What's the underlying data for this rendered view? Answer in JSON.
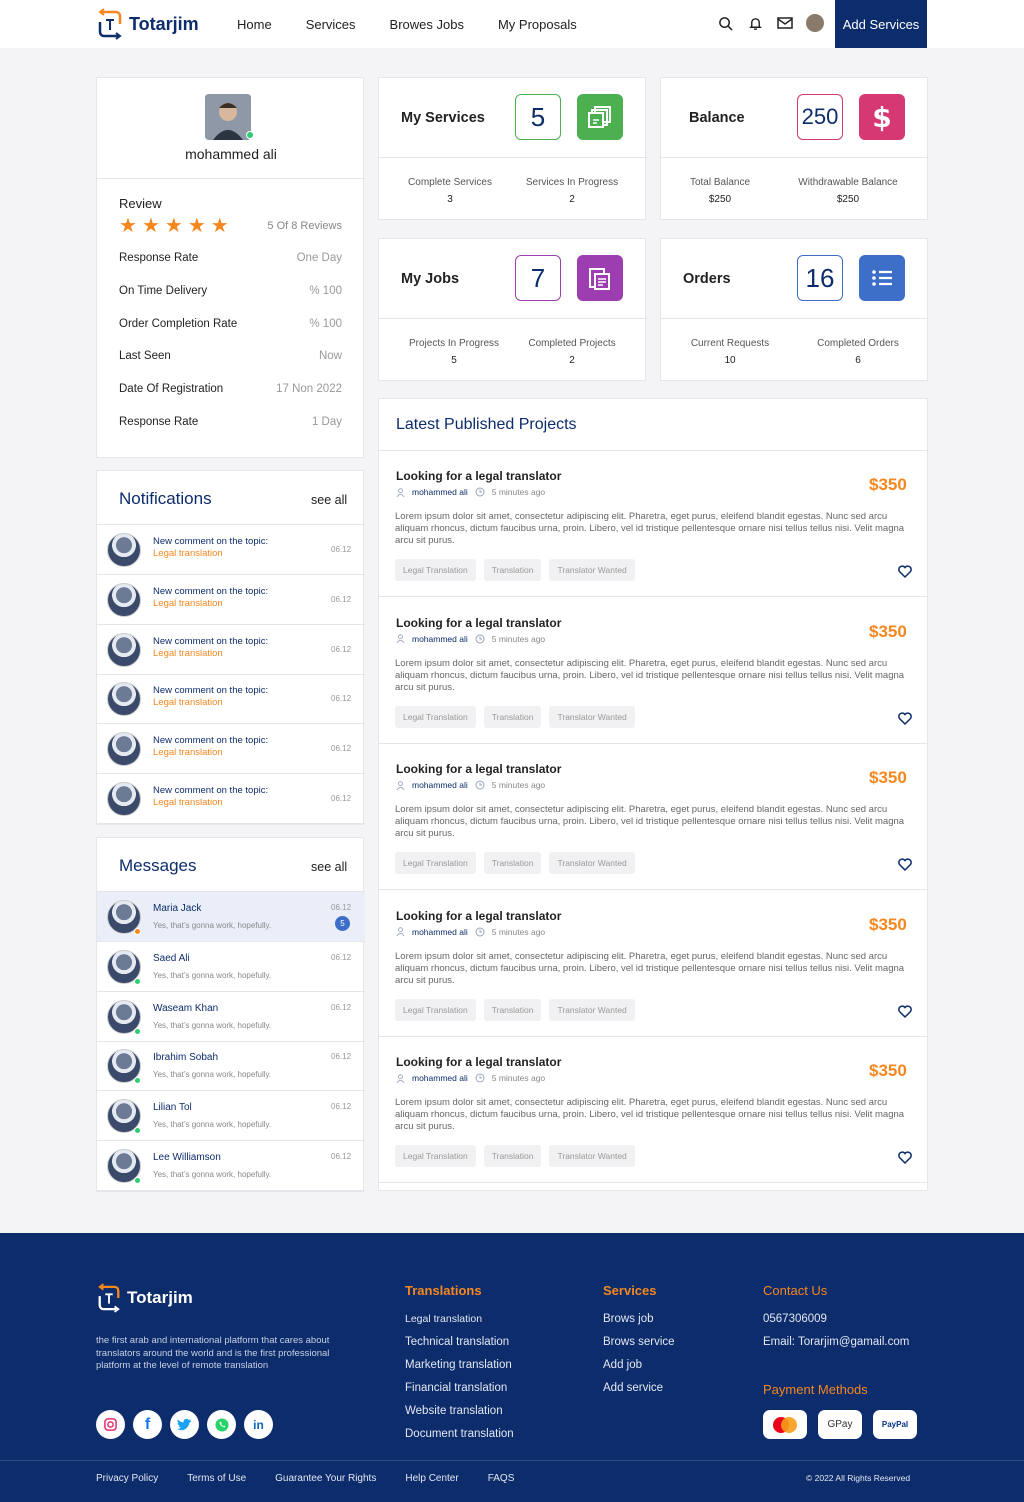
{
  "brand": {
    "name": "Totarjim"
  },
  "nav": [
    "Home",
    "Services",
    "Browes Jobs",
    "My Proposals"
  ],
  "header": {
    "add_button": "Add Services"
  },
  "profile": {
    "name": "mohammed ali",
    "review_label": "Review",
    "rating": 5,
    "review_count": "5 Of 8 Reviews",
    "stats": [
      {
        "label": "Response Rate",
        "value": "One Day"
      },
      {
        "label": "On Time Delivery",
        "value": "% 100"
      },
      {
        "label": "Order Completion Rate",
        "value": "% 100"
      },
      {
        "label": "Last Seen",
        "value": "Now"
      },
      {
        "label": "Date Of Registration",
        "value": "17 Non 2022"
      },
      {
        "label": "Response Rate",
        "value": "1 Day"
      }
    ]
  },
  "stat_boxes": [
    {
      "title": "My Services",
      "number": "5",
      "color": "#4caf50",
      "left_label": "Complete Services",
      "left_value": "3",
      "right_label": "Services In Progress",
      "right_value": "2"
    },
    {
      "title": "Balance",
      "number": "250",
      "color": "#d63874",
      "left_label": "Total Balance",
      "left_value": "$250",
      "right_label": "Withdrawable Balance",
      "right_value": "$250"
    },
    {
      "title": "My Jobs",
      "number": "7",
      "color": "#9c3eb0",
      "left_label": "Projects In Progress",
      "left_value": "5",
      "right_label": "Completed Projects",
      "right_value": "2"
    },
    {
      "title": "Orders",
      "number": "16",
      "color": "#3d6fc9",
      "left_label": "Current Requests",
      "left_value": "10",
      "right_label": "Completed Orders",
      "right_value": "6"
    }
  ],
  "notifications": {
    "title": "Notifications",
    "see_all": "see all",
    "items": [
      {
        "text": "New comment on the topic:",
        "topic": "Legal translation",
        "time": "06.12"
      },
      {
        "text": "New comment on the topic:",
        "topic": "Legal translation",
        "time": "06.12"
      },
      {
        "text": "New comment on the topic:",
        "topic": "Legal translation",
        "time": "06.12"
      },
      {
        "text": "New comment on the topic:",
        "topic": "Legal translation",
        "time": "06.12"
      },
      {
        "text": "New comment on the topic:",
        "topic": "Legal translation",
        "time": "06.12"
      },
      {
        "text": "New comment on the topic:",
        "topic": "Legal translation",
        "time": "06.12"
      }
    ]
  },
  "messages": {
    "title": "Messages",
    "see_all": "see all",
    "items": [
      {
        "name": "Maria Jack",
        "text": "Yes, that’s gonna work, hopefully.",
        "time": "06.12",
        "badge": "5",
        "status_color": "#f5871f"
      },
      {
        "name": "Saed Ali",
        "text": "Yes, that’s gonna work, hopefully.",
        "time": "06.12",
        "badge": "",
        "status_color": "#2ecc71"
      },
      {
        "name": "Waseam Khan",
        "text": "Yes, that’s gonna work, hopefully.",
        "time": "06.12",
        "badge": "",
        "status_color": "#2ecc71"
      },
      {
        "name": "Ibrahim Sobah",
        "text": "Yes, that’s gonna work, hopefully.",
        "time": "06.12",
        "badge": "",
        "status_color": "#2ecc71"
      },
      {
        "name": "Lilian Tol",
        "text": "Yes, that’s gonna work, hopefully.",
        "time": "06.12",
        "badge": "",
        "status_color": "#2ecc71"
      },
      {
        "name": "Lee Williamson",
        "text": "Yes, that’s gonna work, hopefully.",
        "time": "06.12",
        "badge": "",
        "status_color": "#2ecc71"
      }
    ]
  },
  "latest": {
    "title": "Latest Published Projects",
    "projects": [
      {
        "title": "Looking for a legal translator",
        "author": "mohammed ali",
        "time": "5 minutes ago",
        "price": "$350",
        "desc": "Lorem ipsum dolor sit amet, consectetur adipiscing elit. Pharetra, eget purus, eleifend blandit egestas. Nunc sed arcu aliquam rhoncus, dictum faucibus urna, proin. Libero, vel id tristique pellentesque ornare nisi tellus tellus nisi. Velit magna arcu sit purus.",
        "tags": [
          "Legal Translation",
          "Translation",
          "Translator Wanted"
        ]
      },
      {
        "title": "Looking for a legal translator",
        "author": "mohammed ali",
        "time": "5 minutes ago",
        "price": "$350",
        "desc": "Lorem ipsum dolor sit amet, consectetur adipiscing elit. Pharetra, eget purus, eleifend blandit egestas. Nunc sed arcu aliquam rhoncus, dictum faucibus urna, proin. Libero, vel id tristique pellentesque ornare nisi tellus tellus nisi. Velit magna arcu sit purus.",
        "tags": [
          "Legal Translation",
          "Translation",
          "Translator Wanted"
        ]
      },
      {
        "title": "Looking for a legal translator",
        "author": "mohammed ali",
        "time": "5 minutes ago",
        "price": "$350",
        "desc": "Lorem ipsum dolor sit amet, consectetur adipiscing elit. Pharetra, eget purus, eleifend blandit egestas. Nunc sed arcu aliquam rhoncus, dictum faucibus urna, proin. Libero, vel id tristique pellentesque ornare nisi tellus tellus nisi. Velit magna arcu sit purus.",
        "tags": [
          "Legal Translation",
          "Translation",
          "Translator Wanted"
        ]
      },
      {
        "title": "Looking for a legal translator",
        "author": "mohammed ali",
        "time": "5 minutes ago",
        "price": "$350",
        "desc": "Lorem ipsum dolor sit amet, consectetur adipiscing elit. Pharetra, eget purus, eleifend blandit egestas. Nunc sed arcu aliquam rhoncus, dictum faucibus urna, proin. Libero, vel id tristique pellentesque ornare nisi tellus tellus nisi. Velit magna arcu sit purus.",
        "tags": [
          "Legal Translation",
          "Translation",
          "Translator Wanted"
        ]
      },
      {
        "title": "Looking for a legal translator",
        "author": "mohammed ali",
        "time": "5 minutes ago",
        "price": "$350",
        "desc": "Lorem ipsum dolor sit amet, consectetur adipiscing elit. Pharetra, eget purus, eleifend blandit egestas. Nunc sed arcu aliquam rhoncus, dictum faucibus urna, proin. Libero, vel id tristique pellentesque ornare nisi tellus tellus nisi. Velit magna arcu sit purus.",
        "tags": [
          "Legal Translation",
          "Translation",
          "Translator Wanted"
        ]
      }
    ]
  },
  "footer": {
    "brand": "Totarjim",
    "description": "the first arab and international platform that cares about translators around the world and is the first professional platform at the level of remote translation",
    "socials": [
      "instagram-icon",
      "facebook-icon",
      "twitter-icon",
      "whatsapp-icon",
      "linkedin-icon"
    ],
    "translations": {
      "title": "Translations",
      "items": [
        "Legal translation",
        "Technical translation",
        "Marketing translation",
        "Financial translation",
        "Website translation",
        "Document translation"
      ]
    },
    "services": {
      "title": "Services",
      "items": [
        "Brows job",
        "Brows service",
        "Add job",
        "Add service"
      ]
    },
    "contact": {
      "title": "Contact Us",
      "phone": "0567306009",
      "email": "Email: Torarjim@gamail.com"
    },
    "payment": {
      "title": "Payment Methods",
      "methods": [
        "mastercard-icon",
        "GPay",
        "PayPal"
      ]
    },
    "links": [
      "Privacy Policy",
      "Terms of Use",
      "Guarantee Your Rights",
      "Help Center",
      "FAQS"
    ],
    "copyright": "© 2022 All Rights Reserved"
  }
}
